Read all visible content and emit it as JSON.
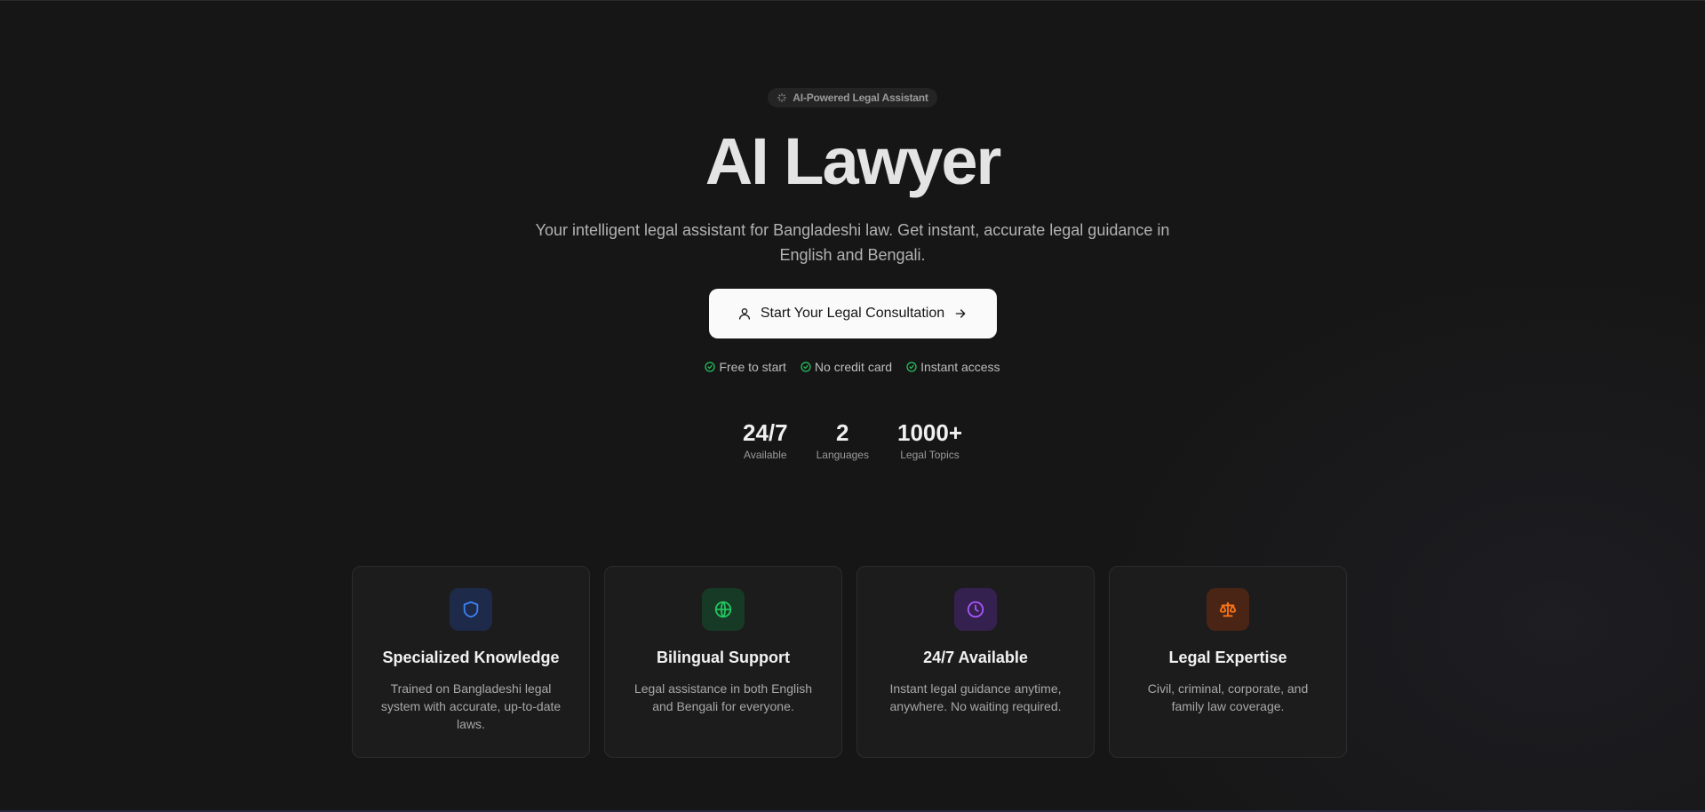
{
  "badge": {
    "icon": "sparkles-icon",
    "label": "AI-Powered Legal Assistant"
  },
  "hero": {
    "title": "AI Lawyer",
    "subtitle": "Your intelligent legal assistant for Bangladeshi law. Get instant, accurate legal guidance in English and Bengali."
  },
  "cta": {
    "icon": "user-icon",
    "label": "Start Your Legal Consultation",
    "trailing_icon": "arrow-right-icon"
  },
  "perks": [
    {
      "icon": "check-circle-icon",
      "label": "Free to start"
    },
    {
      "icon": "check-circle-icon",
      "label": "No credit card"
    },
    {
      "icon": "check-circle-icon",
      "label": "Instant access"
    }
  ],
  "stats": [
    {
      "value": "24/7",
      "label": "Available"
    },
    {
      "value": "2",
      "label": "Languages"
    },
    {
      "value": "1000+",
      "label": "Legal Topics"
    }
  ],
  "features": [
    {
      "icon": "shield-icon",
      "color": "#3b82f6",
      "bg": "#1e2a4a",
      "title": "Specialized Knowledge",
      "description": "Trained on Bangladeshi legal system with accurate, up-to-date laws."
    },
    {
      "icon": "globe-icon",
      "color": "#22c55e",
      "bg": "#173a26",
      "title": "Bilingual Support",
      "description": "Legal assistance in both English and Bengali for everyone."
    },
    {
      "icon": "clock-icon",
      "color": "#a855f7",
      "bg": "#35214f",
      "title": "24/7 Available",
      "description": "Instant legal guidance anytime, anywhere. No waiting required."
    },
    {
      "icon": "scale-icon",
      "color": "#f97316",
      "bg": "#4a2516",
      "title": "Legal Expertise",
      "description": "Civil, criminal, corporate, and family law coverage."
    }
  ],
  "colors": {
    "background": "#161616",
    "check": "#22c55e",
    "cta_bg": "#fafafa"
  }
}
